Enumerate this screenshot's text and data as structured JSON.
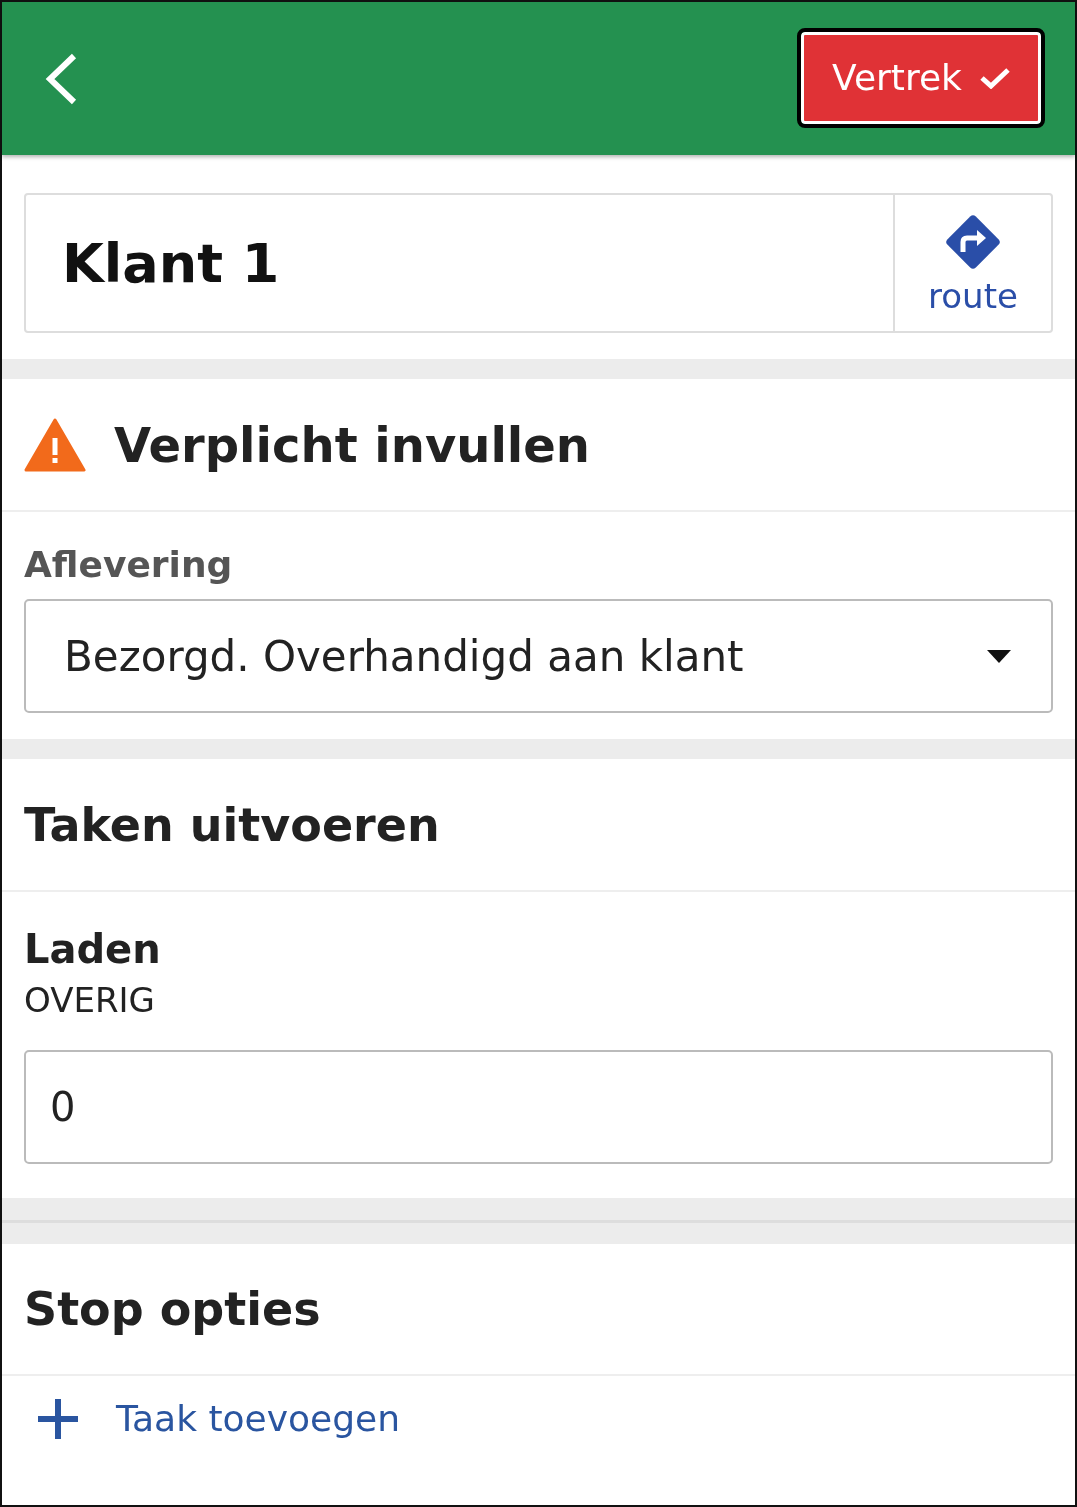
{
  "header": {
    "depart_button": "Vertrek"
  },
  "customer": {
    "name": "Klant 1",
    "route_label": "route"
  },
  "alert": {
    "title": "Verplicht invullen"
  },
  "delivery": {
    "label": "Aflevering",
    "value": "Bezorgd. Overhandigd aan klant"
  },
  "tasks": {
    "title": "Taken uitvoeren",
    "items": [
      {
        "name": "Laden",
        "category": "OVERIG",
        "value": "0"
      }
    ]
  },
  "stop_options": {
    "title": "Stop opties",
    "action": "Taak toevoegen"
  }
}
